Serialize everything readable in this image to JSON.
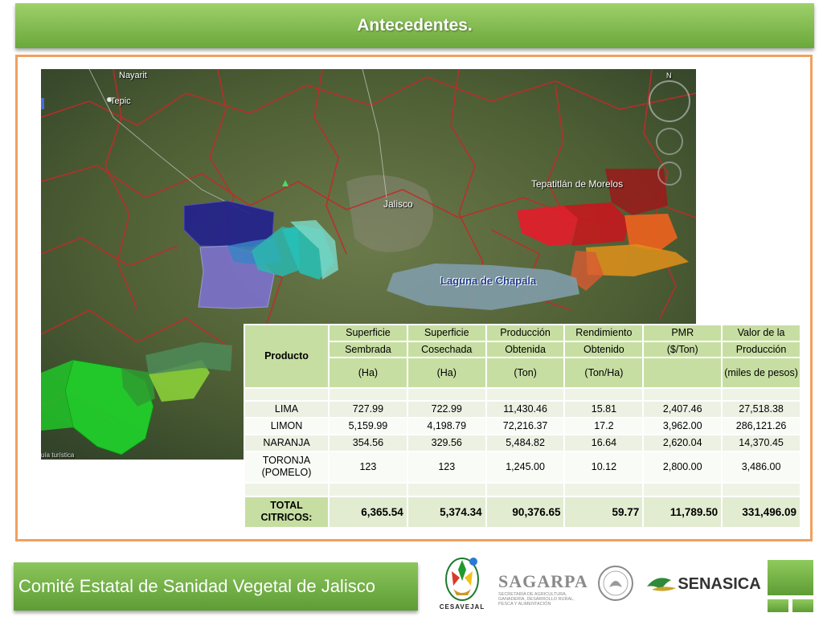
{
  "header": {
    "title": "Antecedentes."
  },
  "map": {
    "labels": {
      "nayarit": "Nayarit",
      "tepic": "Tepic",
      "tepatitlan": "Tepatitlán de Morelos",
      "jalisco": "Jalisco",
      "laguna": "Laguna de Chapala",
      "guide": "uía turística",
      "compass": "N"
    }
  },
  "table": {
    "product_header": "Producto",
    "columns": [
      {
        "line1": "Superficie",
        "line2": "Sembrada",
        "unit": "(Ha)"
      },
      {
        "line1": "Superficie",
        "line2": "Cosechada",
        "unit": "(Ha)"
      },
      {
        "line1": "Producción",
        "line2": "Obtenida",
        "unit": "(Ton)"
      },
      {
        "line1": "Rendimiento",
        "line2": "Obtenido",
        "unit": "(Ton/Ha)"
      },
      {
        "line1": "PMR",
        "line2": "($/Ton)",
        "unit": ""
      },
      {
        "line1": "Valor de la",
        "line2": "Producción",
        "unit": "(miles de pesos)"
      }
    ],
    "rows": [
      {
        "name": "LIMA",
        "values": [
          "727.99",
          "722.99",
          "11,430.46",
          "15.81",
          "2,407.46",
          "27,518.38"
        ]
      },
      {
        "name": "LIMON",
        "values": [
          "5,159.99",
          "4,198.79",
          "72,216.37",
          "17.2",
          "3,962.00",
          "286,121.26"
        ]
      },
      {
        "name": "NARANJA",
        "values": [
          "354.56",
          "329.56",
          "5,484.82",
          "16.64",
          "2,620.04",
          "14,370.45"
        ]
      },
      {
        "name": "TORONJA (POMELO)",
        "values": [
          "123",
          "123",
          "1,245.00",
          "10.12",
          "2,800.00",
          "3,486.00"
        ]
      }
    ],
    "total": {
      "name": "TOTAL CITRICOS:",
      "values": [
        "6,365.54",
        "5,374.34",
        "90,376.65",
        "59.77",
        "11,789.50",
        "331,496.09"
      ]
    }
  },
  "footer": {
    "title": "Comité Estatal de Sanidad Vegetal de Jalisco",
    "logos": {
      "cesavejal": "CESAVEJAL",
      "sagarpa": "SAGARPA",
      "sagarpa_sub": "SECRETARÍA DE AGRICULTURA, GANADERÍA, DESARROLLO RURAL, PESCA Y ALIMENTACIÓN",
      "senasica": "SENASICA"
    }
  }
}
